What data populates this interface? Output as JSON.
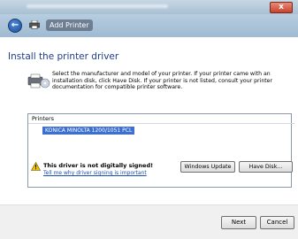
{
  "window": {
    "close_label": "x"
  },
  "nav": {
    "back_label": "←",
    "title": "Add Printer"
  },
  "page": {
    "heading": "Install the printer driver",
    "description": "Select the manufacturer and model of your printer. If your printer came with an installation disk, click Have Disk. If your printer is not listed, consult your printer documentation for compatible printer software."
  },
  "printers": {
    "header": "Printers",
    "items": [
      "KONICA MINOLTA 1200/1051 PCL"
    ]
  },
  "warning": {
    "text": "This driver is not digitally signed!",
    "link": "Tell me why driver signing is important"
  },
  "buttons": {
    "windows_update": "Windows Update",
    "have_disk": "Have Disk...",
    "next": "Next",
    "cancel": "Cancel"
  },
  "icons": {
    "warning_color": "#f2c500",
    "back_color": "#1f4f9a"
  }
}
